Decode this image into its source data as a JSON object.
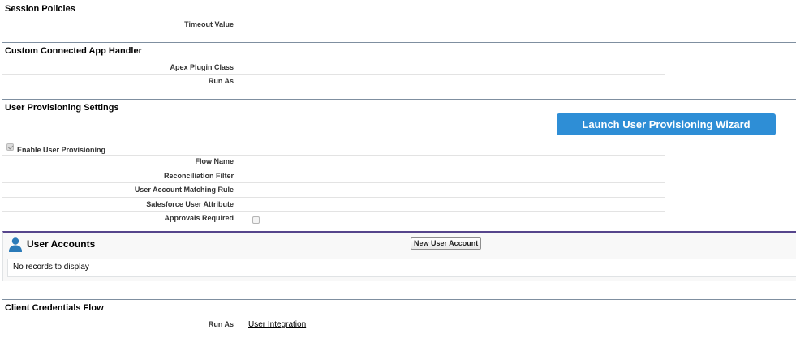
{
  "session_policies": {
    "title": "Session Policies",
    "timeout_value_label": "Timeout Value"
  },
  "connected_app_handler": {
    "title": "Custom Connected App Handler",
    "apex_plugin_class_label": "Apex Plugin Class",
    "run_as_label": "Run As"
  },
  "user_provisioning": {
    "title": "User Provisioning Settings",
    "wizard_button": "Launch User Provisioning Wizard",
    "enable_label": "Enable User Provisioning",
    "enable_checked": true,
    "flow_name_label": "Flow Name",
    "reconciliation_filter_label": "Reconciliation Filter",
    "matching_rule_label": "User Account Matching Rule",
    "sf_user_attribute_label": "Salesforce User Attribute",
    "approvals_required_label": "Approvals Required",
    "approvals_required_checked": false
  },
  "user_accounts": {
    "title": "User Accounts",
    "icon": "user-icon",
    "new_button": "New User Account",
    "empty_message": "No records to display",
    "accent_color": "#56458c"
  },
  "client_credentials": {
    "title": "Client Credentials Flow",
    "run_as_label": "Run As",
    "run_as_value": "User Integration"
  },
  "colors": {
    "primary_button": "#2e8ed6",
    "section_rule": "#7f8fa0"
  }
}
